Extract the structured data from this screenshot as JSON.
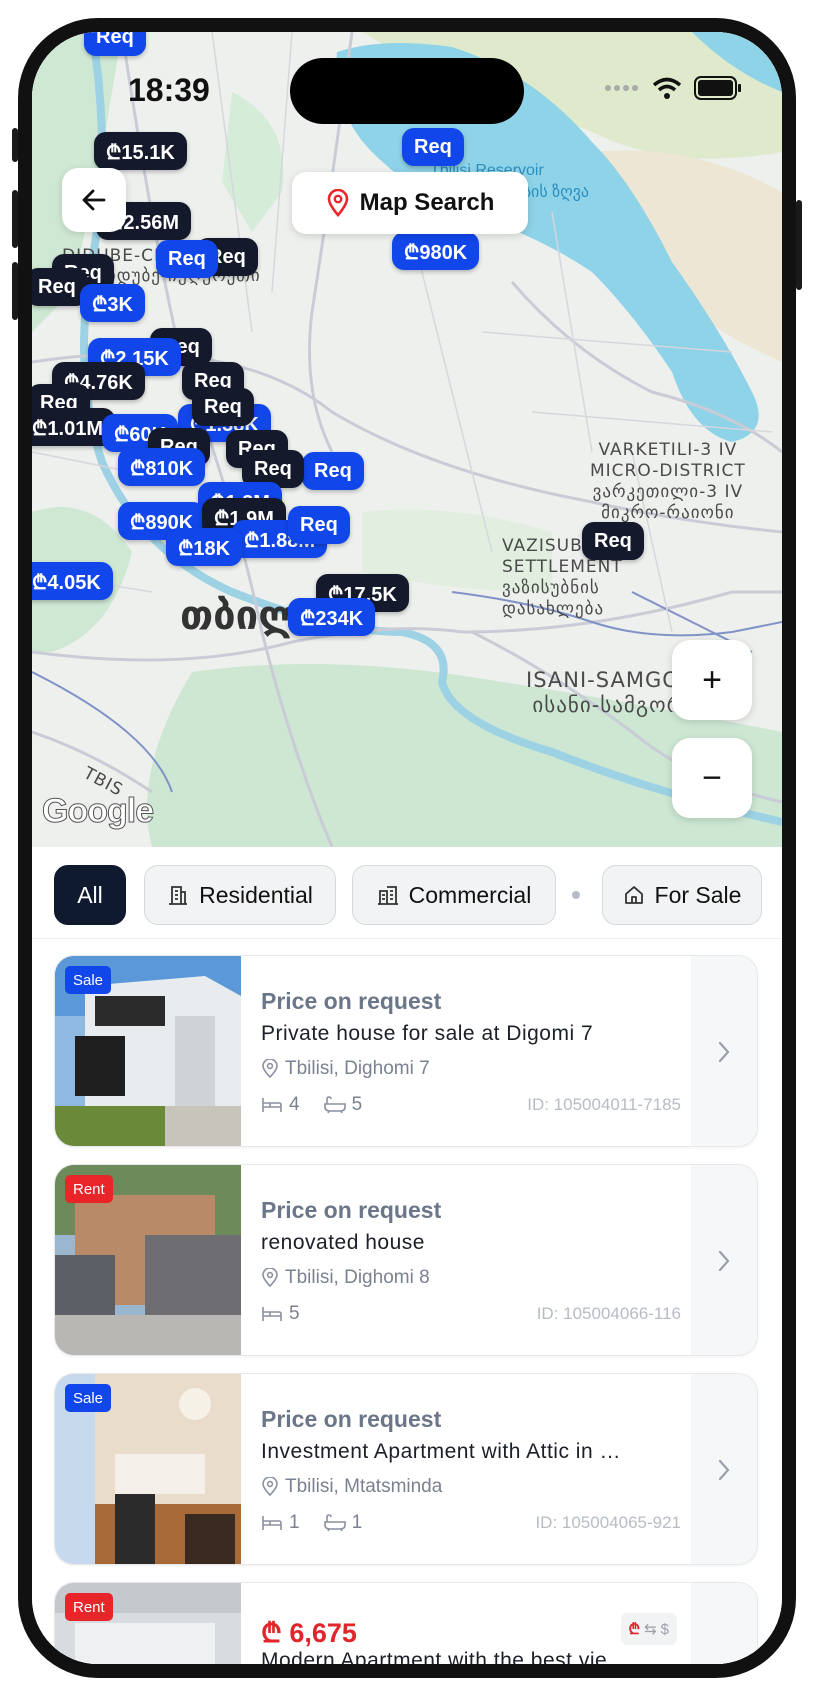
{
  "status": {
    "time": "18:39"
  },
  "header": {
    "title": "Map Search"
  },
  "map": {
    "labels": {
      "didube": "DIDUBE-CHUGURETI",
      "didube_ka": "დიდუბე-ჩუღურეთი",
      "varketili": "VARKETILI-3 IV\nMICRO-DISTRICT\nვარკეთილი-3 IV\nმიკრო-რაიონი",
      "vazisubani": "VAZISUBANI\nSETTLEMENT\nვაზისუბნის\nდასახლება",
      "isani": "ISANI-SAMGORI\nისანი-სამგორი",
      "tbilisi_ka": "თბილისი",
      "reservoir": "Tbilisi Reservoir",
      "reservoir_ka": "თბილისის ზღვა",
      "tbis": "TBIS",
      "google": "Google"
    },
    "pins": [
      {
        "label": "Req",
        "style": "blue"
      },
      {
        "label": "₾15.1K",
        "style": "dark"
      },
      {
        "label": "Req",
        "style": "blue"
      },
      {
        "label": "₾2.56M",
        "style": "dark"
      },
      {
        "label": "₾980K",
        "style": "blue"
      },
      {
        "label": "Req",
        "style": "dark"
      },
      {
        "label": "Req",
        "style": "blue"
      },
      {
        "label": "Req",
        "style": "dark"
      },
      {
        "label": "Req",
        "style": "dark"
      },
      {
        "label": "₾3K",
        "style": "blue"
      },
      {
        "label": "Req",
        "style": "dark"
      },
      {
        "label": "₾2.15K",
        "style": "blue"
      },
      {
        "label": "₾4.76K",
        "style": "dark"
      },
      {
        "label": "Req",
        "style": "dark"
      },
      {
        "label": "Req",
        "style": "dark"
      },
      {
        "label": "₾1.38K",
        "style": "blue"
      },
      {
        "label": "₾1.01M",
        "style": "dark"
      },
      {
        "label": "₾60K",
        "style": "blue"
      },
      {
        "label": "Req",
        "style": "dark"
      },
      {
        "label": "Req",
        "style": "dark"
      },
      {
        "label": "₾810K",
        "style": "blue"
      },
      {
        "label": "Req",
        "style": "dark"
      },
      {
        "label": "Req",
        "style": "blue"
      },
      {
        "label": "Req",
        "style": "dark"
      },
      {
        "label": "₾1.3M",
        "style": "blue"
      },
      {
        "label": "₾890K",
        "style": "blue"
      },
      {
        "label": "₾1.9M",
        "style": "dark"
      },
      {
        "label": "₾1.88M",
        "style": "blue"
      },
      {
        "label": "₾18K",
        "style": "blue"
      },
      {
        "label": "Req",
        "style": "blue"
      },
      {
        "label": "Req",
        "style": "dark"
      },
      {
        "label": "₾4.05K",
        "style": "blue"
      },
      {
        "label": "₾17.5K",
        "style": "dark"
      },
      {
        "label": "₾234K",
        "style": "blue"
      }
    ],
    "zoom_in": "+",
    "zoom_out": "−"
  },
  "filters": {
    "chips": [
      {
        "label": "All",
        "active": true
      },
      {
        "label": "Residential",
        "icon": "building-icon"
      },
      {
        "label": "Commercial",
        "icon": "office-icon"
      },
      {
        "label": "For Sale",
        "icon": "home-icon"
      }
    ]
  },
  "listings": [
    {
      "badge": "Sale",
      "price": "Price on request",
      "title": "Private house for sale at Digomi 7",
      "location": "Tbilisi, Dighomi 7",
      "beds": "4",
      "baths": "5",
      "id": "ID: 105004011-7185"
    },
    {
      "badge": "Rent",
      "price": "Price on request",
      "title": "renovated house",
      "location": "Tbilisi, Dighomi 8",
      "beds": "5",
      "id": "ID: 105004066-116"
    },
    {
      "badge": "Sale",
      "price": "Price on request",
      "title": "Investment Apartment with Attic in …",
      "location": "Tbilisi, Mtatsminda",
      "beds": "1",
      "baths": "1",
      "id": "ID: 105004065-921"
    },
    {
      "badge": "Rent",
      "price": "₾ 6,675",
      "title": "Modern Apartment with the best vie…",
      "currency_from": "₾",
      "currency_to": "$"
    }
  ],
  "colors": {
    "brand_blue": "#1146ea",
    "dark_navy": "#0f1a2e",
    "rent_red": "#e8262a"
  }
}
